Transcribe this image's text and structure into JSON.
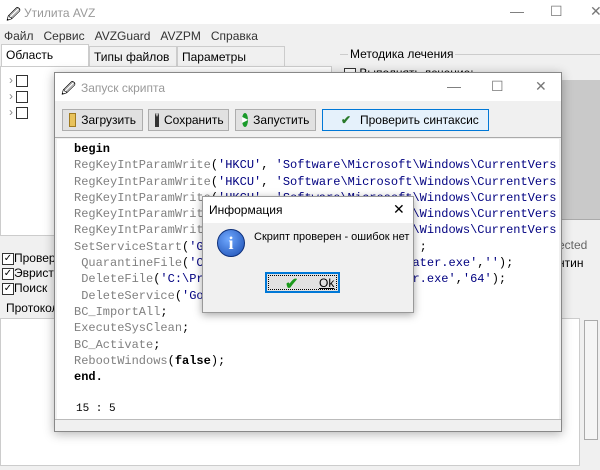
{
  "main_window": {
    "title": "Утилита AVZ",
    "controls": {
      "minimize": "—",
      "maximize": "☐",
      "close": "✕"
    }
  },
  "menu": [
    "Файл",
    "Сервис",
    "AVZGuard",
    "AVZPM",
    "Справка"
  ],
  "tabs": [
    "Область поиска",
    "Типы файлов",
    "Параметры поиска"
  ],
  "treatment_group": {
    "title": "Методика лечения",
    "checkbox": "Выполнять лечение:"
  },
  "options": [
    "Провер",
    "Эврист",
    "Поиск"
  ],
  "log_tab": "Протокол",
  "right_fragments": [
    "ected",
    "нтин"
  ],
  "script_window": {
    "title": "Запуск скрипта",
    "controls": {
      "minimize": "—",
      "maximize": "☐",
      "close": "✕"
    },
    "toolbar": [
      {
        "label": "Загрузить",
        "icon": "folder-open-icon"
      },
      {
        "label": "Сохранить",
        "icon": "floppy-disk-icon"
      },
      {
        "label": "Запустить",
        "icon": "play-icon"
      },
      {
        "label": "Проверить синтаксис",
        "icon": "check-syntax-icon"
      }
    ],
    "code": [
      [
        [
          "begin",
          "k"
        ]
      ],
      [
        [
          "RegKeyIntParamWrite",
          "f"
        ],
        [
          "(",
          "p"
        ],
        [
          "'HKCU'",
          "s"
        ],
        [
          ", ",
          "p"
        ],
        [
          "'Software\\Microsoft\\Windows\\CurrentVers",
          "s"
        ]
      ],
      [
        [
          "RegKeyIntParamWrite",
          "f"
        ],
        [
          "(",
          "p"
        ],
        [
          "'HKCU'",
          "s"
        ],
        [
          ", ",
          "p"
        ],
        [
          "'Software\\Microsoft\\Windows\\CurrentVers",
          "s"
        ]
      ],
      [
        [
          "RegKeyIntParamWrite",
          "f"
        ],
        [
          "(",
          "p"
        ],
        [
          "'HKCU'",
          "s"
        ],
        [
          ", ",
          "p"
        ],
        [
          "'Software\\Microsoft\\Windows\\CurrentVers",
          "s"
        ]
      ],
      [
        [
          "RegKeyIntParamWrit",
          "f"
        ],
        [
          "                             \\Windows\\CurrentVers",
          "s"
        ]
      ],
      [
        [
          "RegKeyIntParamWrit",
          "f"
        ],
        [
          "                             \\Windows\\CurrentVers",
          "s"
        ]
      ],
      [
        [
          "SetServiceStart",
          "f"
        ],
        [
          "(",
          "p"
        ],
        [
          "'G",
          "s"
        ],
        [
          "                              ;",
          "p"
        ]
      ],
      [
        [
          " QuarantineFile",
          "f"
        ],
        [
          "(",
          "p"
        ],
        [
          "'C",
          "s"
        ],
        [
          "                           ",
          "p"
        ],
        [
          "pdater.exe'",
          "s"
        ],
        [
          ",",
          "p"
        ],
        [
          "''",
          "s"
        ],
        [
          ");",
          "p"
        ]
      ],
      [
        [
          " DeleteFile",
          "f"
        ],
        [
          "(",
          "p"
        ],
        [
          "'C:\\Pr",
          "s"
        ],
        [
          "                            ",
          "p"
        ],
        [
          "er.exe'",
          "s"
        ],
        [
          ",",
          "p"
        ],
        [
          "'64'",
          "s"
        ],
        [
          ");",
          "p"
        ]
      ],
      [
        [
          " DeleteService",
          "f"
        ],
        [
          "(",
          "p"
        ],
        [
          "'Go",
          "s"
        ]
      ],
      [
        [
          "BC_ImportAll",
          "f"
        ],
        [
          ";",
          "p"
        ]
      ],
      [
        [
          "ExecuteSysClean",
          "f"
        ],
        [
          ";",
          "p"
        ]
      ],
      [
        [
          "BC_Activate",
          "f"
        ],
        [
          ";",
          "p"
        ]
      ],
      [
        [
          "RebootWindows",
          "f"
        ],
        [
          "(",
          "p"
        ],
        [
          "false",
          "k"
        ],
        [
          ");",
          "p"
        ]
      ],
      [
        [
          "end.",
          "k"
        ]
      ]
    ],
    "cursor_position": "15 : 5"
  },
  "info_dialog": {
    "title": "Информация",
    "close": "✕",
    "message": "Скрипт проверен - ошибок нет",
    "icon": "info-icon",
    "ok_label": "Ok"
  },
  "colors": {
    "accent": "#0078d7",
    "string": "#000080",
    "function": "#808080"
  }
}
